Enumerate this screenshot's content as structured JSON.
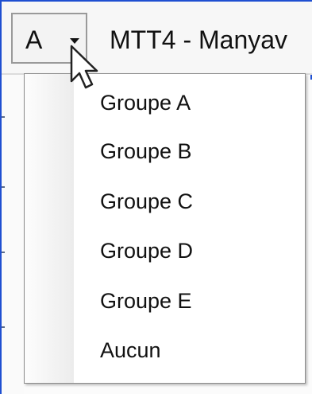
{
  "combo": {
    "selected_value": "A"
  },
  "window": {
    "title": "MTT4  - Manyav"
  },
  "menu": {
    "items": [
      {
        "label": "Groupe A"
      },
      {
        "label": "Groupe B"
      },
      {
        "label": "Groupe C"
      },
      {
        "label": "Groupe D"
      },
      {
        "label": "Groupe E"
      },
      {
        "label": "Aucun"
      }
    ]
  },
  "icons": {
    "combo_arrow": "chevron-down-icon",
    "cursor": "mouse-pointer-icon"
  },
  "colors": {
    "window_edge": "#1f4fd1",
    "menu_border": "#8c8c8c",
    "text": "#111111"
  }
}
